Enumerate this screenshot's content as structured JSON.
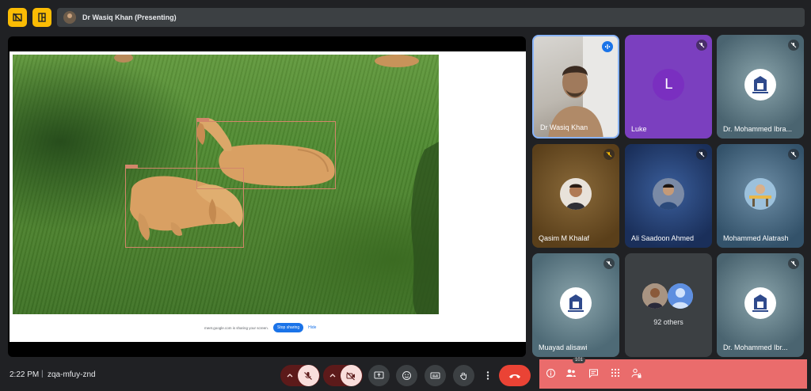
{
  "header": {
    "presenter_label": "Dr Wasiq Khan (Presenting)",
    "left_icons": [
      "sidebar-toggle-icon",
      "layout-icon"
    ]
  },
  "presentation": {
    "share_notice": "meet.google.com is sharing your screen.",
    "stop_sharing": "Stop sharing",
    "hide": "Hide"
  },
  "participants": [
    {
      "name": "Dr Wasiq Khan",
      "status": "speaking",
      "type": "video"
    },
    {
      "name": "Luke",
      "status": "muted",
      "type": "letter",
      "letter": "L",
      "bg": "#7b3fbf"
    },
    {
      "name": "Dr. Mohammed Ibra...",
      "status": "muted",
      "type": "logo",
      "bg": "#4a6470"
    },
    {
      "name": "Qasim M Khalaf",
      "status": "muted",
      "type": "photo",
      "bg": "#6b4a1f"
    },
    {
      "name": "Ali Saadoon Ahmed",
      "status": "muted",
      "type": "photo",
      "bg": "#1f3d72"
    },
    {
      "name": "Mohammed Alatrash",
      "status": "muted",
      "type": "photo",
      "bg": "#3a5a72"
    },
    {
      "name": "Muayad alisawi",
      "status": "muted",
      "type": "logo",
      "bg": "#4e6a76"
    },
    {
      "name": "92 others",
      "status": "",
      "type": "others",
      "bg": "#3c4043"
    },
    {
      "name": "Dr. Mohammed Ibr...",
      "status": "muted",
      "type": "logo",
      "bg": "#4a6470"
    }
  ],
  "footer": {
    "time": "2:22 PM",
    "separator": "|",
    "meeting_code": "zqa-mfuy-znd",
    "people_count": "101"
  },
  "colors": {
    "accent": "#1a73e8",
    "end_call": "#ea4335",
    "host_panel": "#ea6c6c",
    "warning": "#fbbc04"
  }
}
